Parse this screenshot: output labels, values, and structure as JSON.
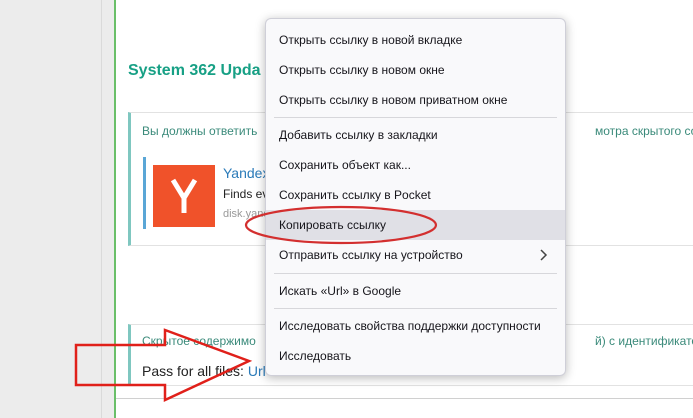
{
  "page": {
    "title": "System 362 Upda",
    "notice_text_left": "Вы должны ответить",
    "notice_text_right": "мотра скрытого содер",
    "embed": {
      "title": "Yandex",
      "description": "Finds eve",
      "domain": "disk.yand",
      "logo_letter": "Y",
      "logo_color": "#f0522a"
    },
    "hidden_notice_left": "Скрытое содержимо",
    "hidden_notice_right": "й) с идентификатором",
    "pass_label": "Pass for all files:",
    "pass_link": "Url"
  },
  "context_menu": {
    "items": [
      {
        "label": "Открыть ссылку в новой вкладке"
      },
      {
        "label": "Открыть ссылку в новом окне"
      },
      {
        "label": "Открыть ссылку в новом приватном окне"
      },
      {
        "label": "Добавить ссылку в закладки"
      },
      {
        "label": "Сохранить объект как..."
      },
      {
        "label": "Сохранить ссылку в Pocket"
      },
      {
        "label": "Копировать ссылку"
      },
      {
        "label": "Отправить ссылку на устройство"
      },
      {
        "label": "Искать «Url» в Google"
      },
      {
        "label": "Исследовать свойства поддержки доступности"
      },
      {
        "label": "Исследовать"
      }
    ],
    "highlighted_item": "Копировать ссылку"
  },
  "annotations": {
    "ellipse_color": "#d32f2f",
    "arrow_color": "#e0201a"
  },
  "colors": {
    "title": "#17a085",
    "link": "#2b7bb9"
  }
}
